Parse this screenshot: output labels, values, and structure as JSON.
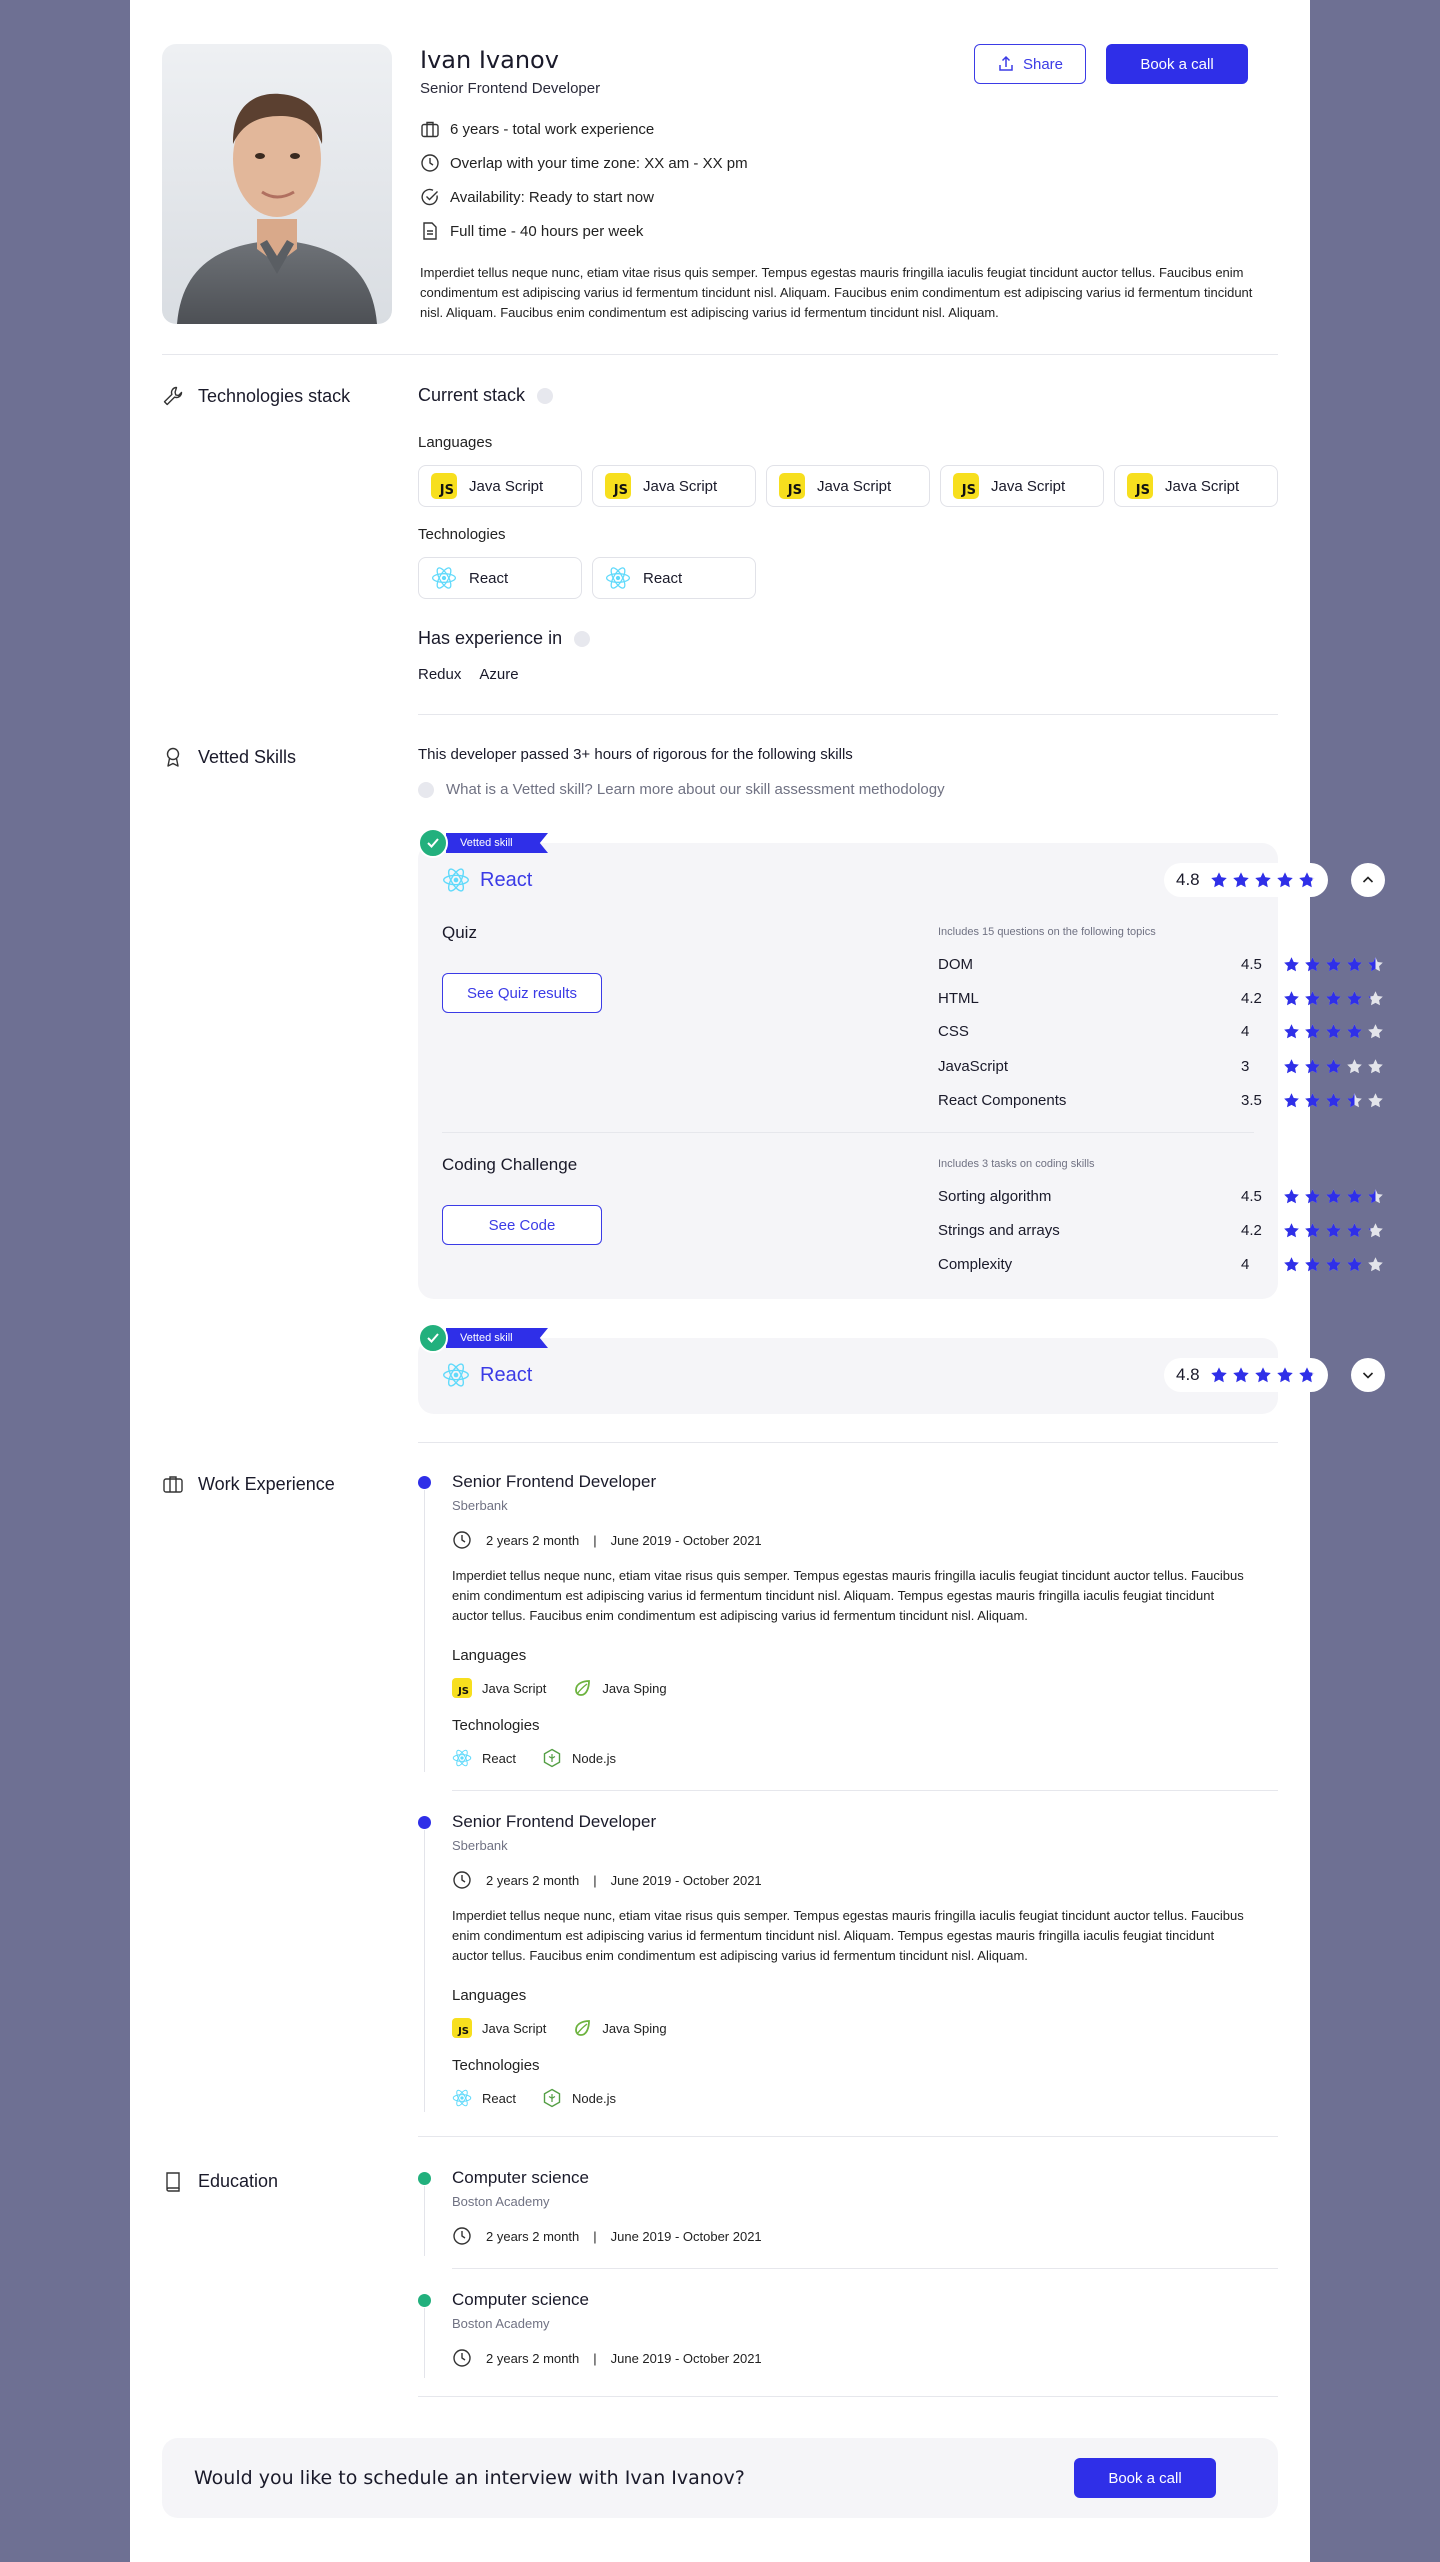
{
  "profile": {
    "name": "Ivan Ivanov",
    "role": "Senior Frontend Developer",
    "facts": [
      "6 years - total work experience",
      "Overlap with your time zone: XX am - XX pm",
      "Availability: Ready to start now",
      "Full time - 40 hours per week"
    ],
    "bio": "Imperdiet tellus neque nunc, etiam vitae risus quis semper. Tempus egestas mauris fringilla iaculis feugiat tincidunt auctor tellus. Faucibus enim condimentum est adipiscing varius id fermentum tincidunt nisl. Aliquam. Faucibus enim condimentum est adipiscing varius id fermentum tincidunt nisl. Aliquam. Faucibus enim condimentum est adipiscing varius id fermentum tincidunt nisl. Aliquam.",
    "share_label": "Share",
    "book_label": "Book a call"
  },
  "tech": {
    "section_title": "Technologies stack",
    "current_stack": "Current stack",
    "languages_label": "Languages",
    "languages": [
      "Java Script",
      "Java Script",
      "Java Script",
      "Java Script",
      "Java Script"
    ],
    "technologies_label": "Technologies",
    "technologies": [
      "React",
      "React"
    ],
    "experience_title": "Has experience in",
    "experience": [
      "Redux",
      "Azure"
    ]
  },
  "vetted": {
    "section_title": "Vetted Skills",
    "intro": "This developer passed 3+ hours of rigorous for the following skills",
    "learn_more": "What is a Vetted skill? Learn more about our skill assessment methodology",
    "ribbon": "Vetted skill",
    "cards": [
      {
        "skill": "React",
        "rating": "4.8",
        "stars": 4.8,
        "quiz": {
          "title": "Quiz",
          "button": "See Quiz results",
          "note": "Includes 15 questions on the following topics",
          "topics": [
            {
              "name": "DOM",
              "score": "4.5",
              "stars": 4.5
            },
            {
              "name": "HTML",
              "score": "4.2",
              "stars": 4.2
            },
            {
              "name": "CSS",
              "score": "4",
              "stars": 4
            },
            {
              "name": "JavaScript",
              "score": "3",
              "stars": 3
            },
            {
              "name": "React Components",
              "score": "3.5",
              "stars": 3.5
            }
          ]
        },
        "coding": {
          "title": "Coding Challenge",
          "button": "See Code",
          "note": "Includes 3 tasks on coding skills",
          "topics": [
            {
              "name": "Sorting algorithm",
              "score": "4.5",
              "stars": 4.5
            },
            {
              "name": "Strings and arrays",
              "score": "4.2",
              "stars": 4.2
            },
            {
              "name": "Complexity",
              "score": "4",
              "stars": 4
            }
          ]
        }
      },
      {
        "skill": "React",
        "rating": "4.8",
        "stars": 4.8
      }
    ]
  },
  "work": {
    "section_title": "Work Experience",
    "jobs": [
      {
        "title": "Senior Frontend Developer",
        "company": "Sberbank",
        "duration": "2 years 2 month",
        "sep": "|",
        "period": "June 2019 - October 2021",
        "text": "Imperdiet tellus neque nunc, etiam vitae risus quis semper. Tempus egestas mauris fringilla iaculis feugiat tincidunt auctor tellus. Faucibus enim condimentum est adipiscing varius id fermentum tincidunt nisl. Aliquam.  Tempus egestas mauris fringilla iaculis feugiat tincidunt auctor tellus. Faucibus enim condimentum est adipiscing varius id fermentum tincidunt nisl. Aliquam.",
        "languages_label": "Languages",
        "languages": [
          "Java Script",
          "Java Sping"
        ],
        "technologies_label": "Technologies",
        "technologies": [
          "React",
          "Node.js"
        ]
      },
      {
        "title": "Senior Frontend Developer",
        "company": "Sberbank",
        "duration": "2 years 2 month",
        "sep": "|",
        "period": "June 2019 - October 2021",
        "text": "Imperdiet tellus neque nunc, etiam vitae risus quis semper. Tempus egestas mauris fringilla iaculis feugiat tincidunt auctor tellus. Faucibus enim condimentum est adipiscing varius id fermentum tincidunt nisl. Aliquam. Tempus egestas mauris fringilla iaculis feugiat tincidunt auctor tellus. Faucibus enim condimentum est adipiscing varius id fermentum tincidunt nisl. Aliquam.",
        "languages_label": "Languages",
        "languages": [
          "Java Script",
          "Java Sping"
        ],
        "technologies_label": "Technologies",
        "technologies": [
          "React",
          "Node.js"
        ]
      }
    ]
  },
  "education": {
    "section_title": "Education",
    "items": [
      {
        "title": "Computer science",
        "school": "Boston Academy",
        "duration": "2 years 2 month",
        "sep": "|",
        "period": "June 2019 - October 2021"
      },
      {
        "title": "Computer science",
        "school": "Boston Academy",
        "duration": "2 years 2 month",
        "sep": "|",
        "period": "June 2019 - October 2021"
      }
    ]
  },
  "cta": {
    "text": "Would you like to schedule an interview with Ivan Ivanov?",
    "button": "Book a call"
  },
  "colors": {
    "accent": "#2f2fe8",
    "star": "#2f2fe8",
    "star_empty": "#e3e4ea",
    "vetted_green": "#22b07d",
    "work_dot": "#2f2fe8",
    "edu_dot": "#22b07d",
    "backdrop": "#6e7093"
  }
}
